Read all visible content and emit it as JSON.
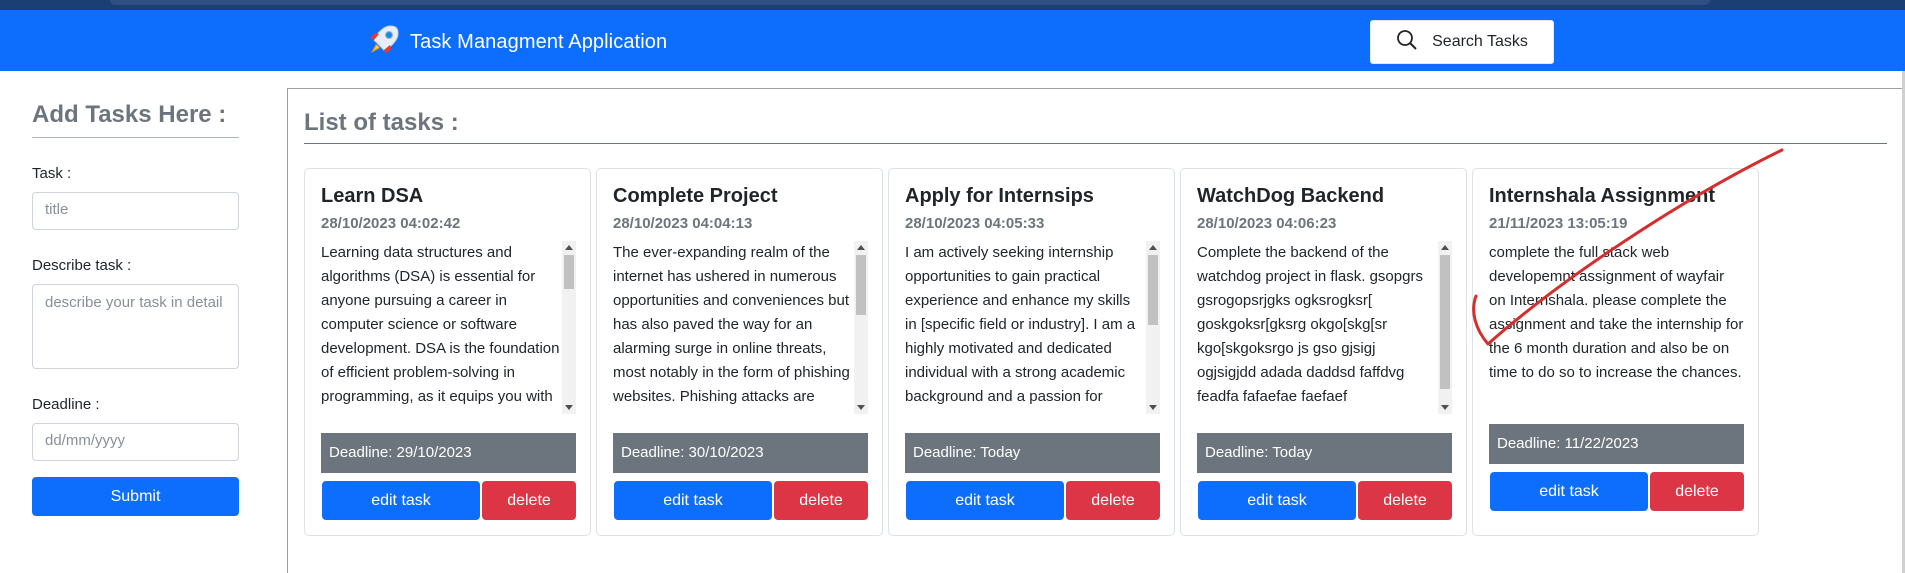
{
  "navbar": {
    "brand_icon": "rocket-icon",
    "brand_text": "Task Managment Application",
    "search_icon": "search-icon",
    "search_label": "Search Tasks",
    "color": "#0d6efd"
  },
  "sidebar": {
    "heading": "Add Tasks Here :",
    "task_label": "Task :",
    "task_placeholder": "title",
    "describe_label": "Describe task :",
    "describe_placeholder": "describe your task in detail",
    "deadline_label": "Deadline :",
    "deadline_placeholder": "dd/mm/yyyy",
    "submit_label": "Submit"
  },
  "main": {
    "heading": "List of tasks :",
    "tasks": [
      {
        "title": "Learn DSA",
        "date": "28/10/2023 04:02:42",
        "description": "Learning data structures and algorithms (DSA) is essential for anyone pursuing a career in computer science or software development. DSA is the foundation of efficient problem-solving in programming, as it equips you with the tools and",
        "deadline": "Deadline: 29/10/2023",
        "edit_label": "edit task",
        "delete_label": "delete"
      },
      {
        "title": "Complete Project",
        "date": "28/10/2023 04:04:13",
        "description": "The ever-expanding realm of the internet has ushered in numerous opportunities and conveniences but has also paved the way for an alarming surge in online threats, most notably in the form of phishing websites. Phishing attacks are",
        "deadline": "Deadline: 30/10/2023",
        "edit_label": "edit task",
        "delete_label": "delete"
      },
      {
        "title": "Apply for Internsips",
        "date": "28/10/2023 04:05:33",
        "description": "I am actively seeking internship opportunities to gain practical experience and enhance my skills in [specific field or industry]. I am a highly motivated and dedicated individual with a strong academic background and a passion for [relevant skills or interests]. I am",
        "deadline": "Deadline: Today",
        "edit_label": "edit task",
        "delete_label": "delete"
      },
      {
        "title": "WatchDog Backend",
        "date": "28/10/2023 04:06:23",
        "description": "Complete the backend of the watchdog project in flask. gsopgrs gsrogopsrjgks ogksrogksr[ goskgoksr[gksrg okgo[skg[sr kgo[skgoksrgo js gso gjsigj ogjsigjdd adada daddsd faffdvg feadfa fafaefae faefaef afaefafaefaefafaefaefafaef",
        "deadline": "Deadline: Today",
        "edit_label": "edit task",
        "delete_label": "delete"
      },
      {
        "title": "Internshala Assignment",
        "date": "21/11/2023 13:05:19",
        "description": "complete the full stack web developemnt assignment of wayfair on Internshala. please complete the assignment and take the internship for the 6 month duration and also be on time to do so to increase the chances.",
        "deadline": "Deadline: 11/22/2023",
        "edit_label": "edit task",
        "delete_label": "delete"
      }
    ]
  },
  "colors": {
    "primary": "#0d6efd",
    "danger": "#dc3545",
    "secondary": "#6c757d",
    "annotation_stroke": "#d32f2f"
  }
}
